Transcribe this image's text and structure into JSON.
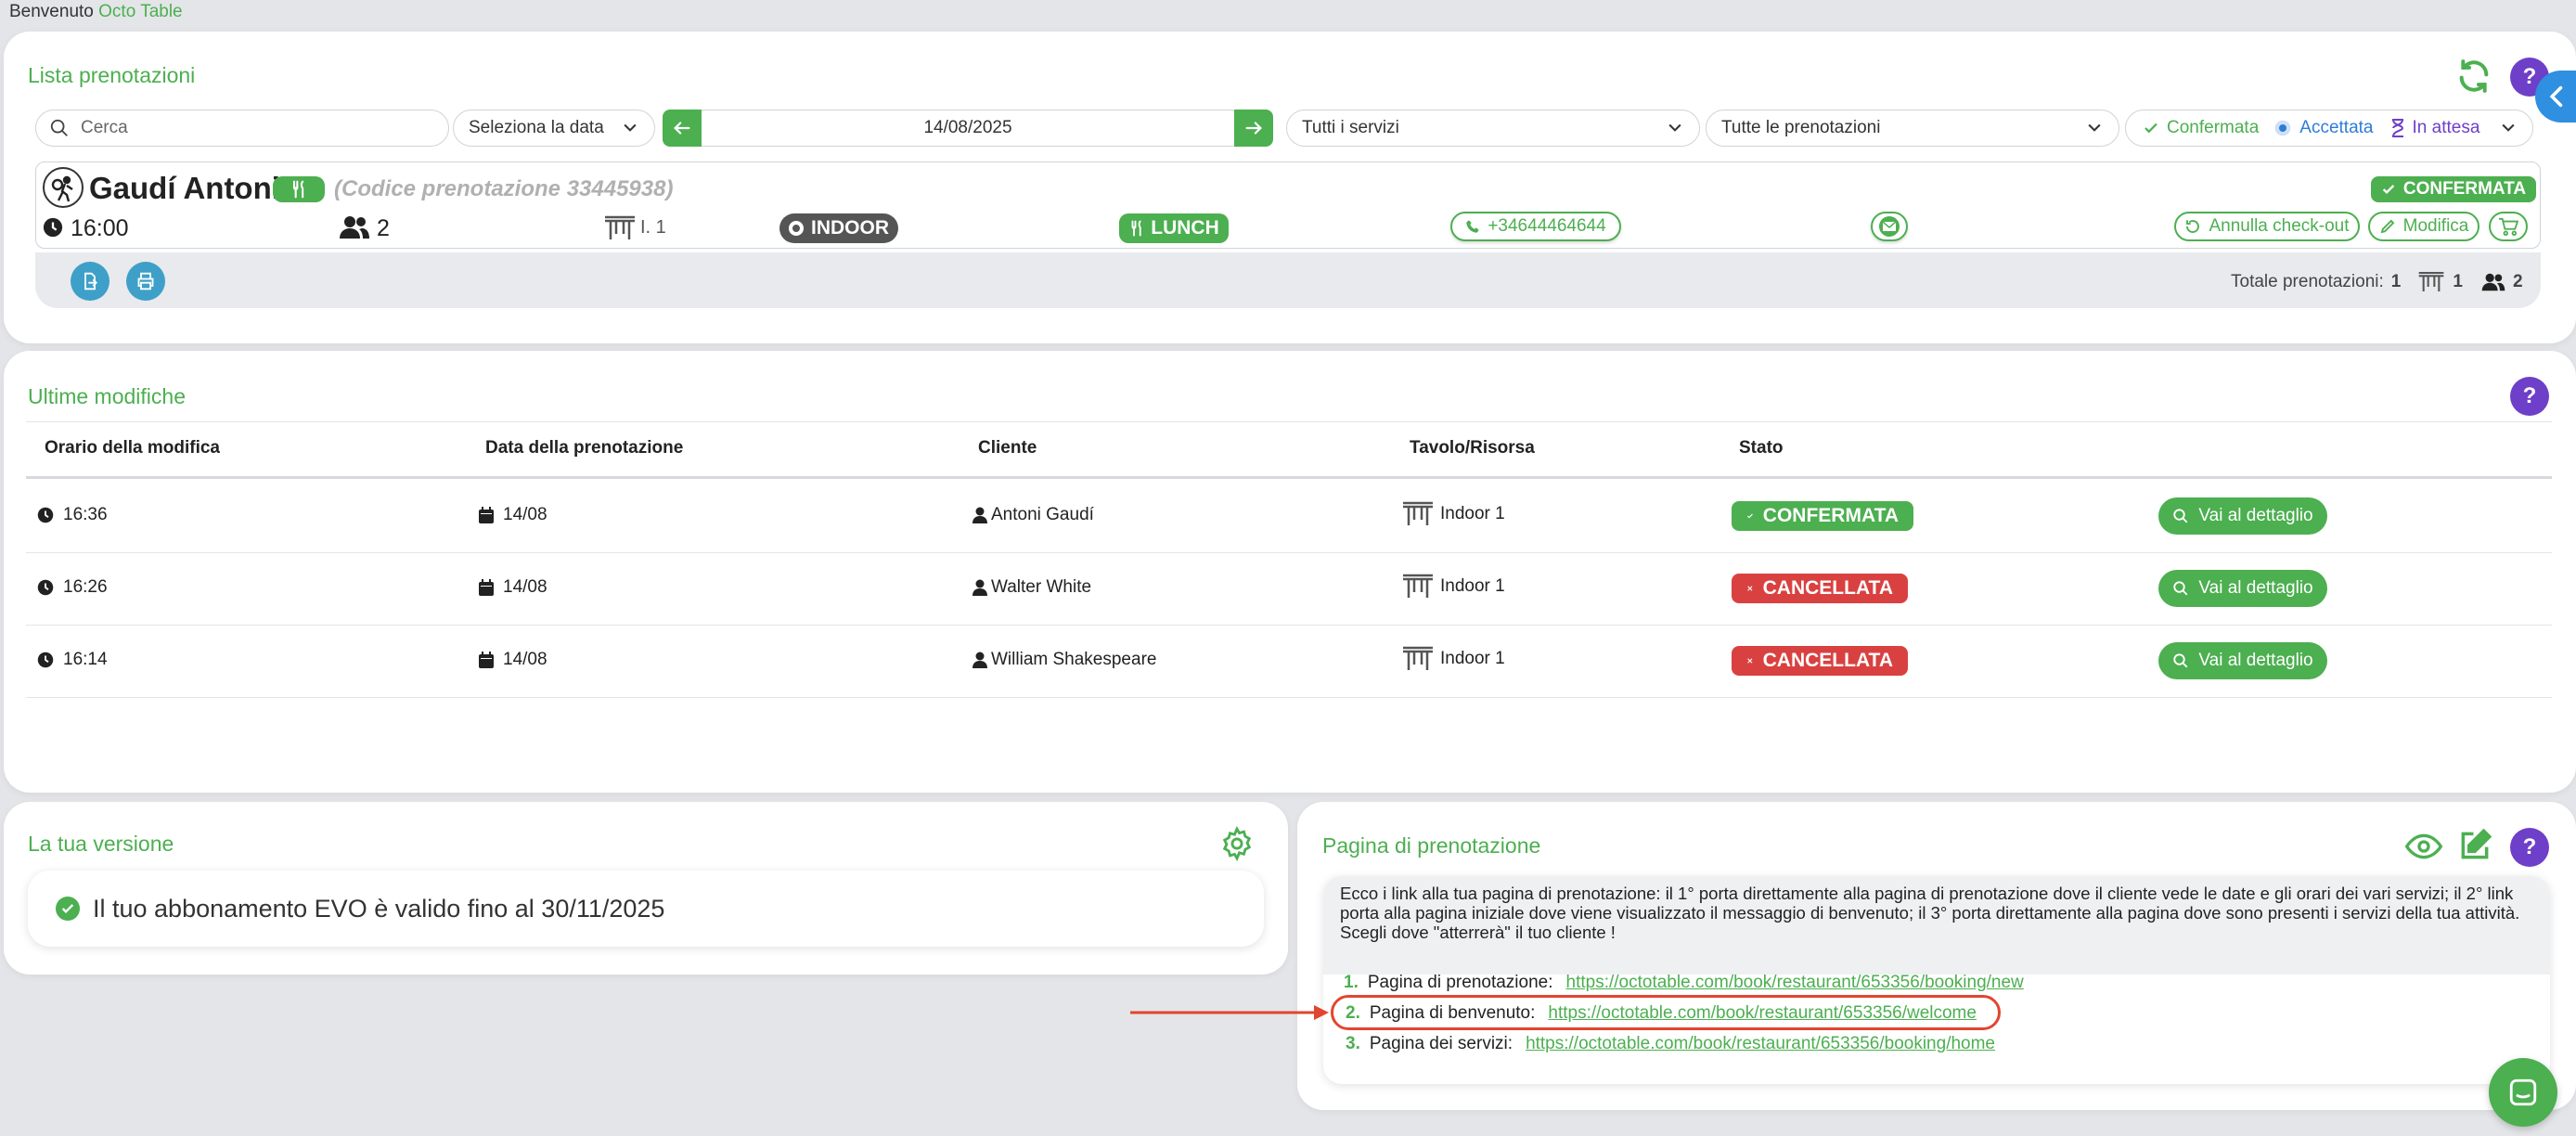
{
  "topbar": {
    "welcome": "Benvenuto",
    "brand": "Octo Table"
  },
  "bookings_list": {
    "title": "Lista prenotazioni",
    "search_placeholder": "Cerca",
    "date_select": "Seleziona la data",
    "date_value": "14/08/2025",
    "services_select": "Tutti i servizi",
    "bookings_select": "Tutte le prenotazioni",
    "legend": {
      "confirmed": "Confermata",
      "accepted": "Accettata",
      "waiting": "In attesa"
    },
    "booking": {
      "name": "Gaudí Antoni",
      "code": "(Codice prenotazione 33445938)",
      "status": "CONFERMATA",
      "time": "16:00",
      "guests": "2",
      "table": "I. 1",
      "area": "INDOOR",
      "service": "LUNCH",
      "phone": "+34644464644",
      "undo_checkout": "Annulla check-out",
      "edit": "Modifica"
    },
    "totals": {
      "label": "Totale prenotazioni:",
      "bookings": "1",
      "tables": "1",
      "guests": "2"
    }
  },
  "recent_changes": {
    "title": "Ultime modifiche",
    "headers": [
      "Orario della modifica",
      "Data della prenotazione",
      "Cliente",
      "Tavolo/Risorsa",
      "Stato"
    ],
    "detail_label": "Vai al dettaglio",
    "rows": [
      {
        "time": "16:36",
        "date": "14/08",
        "client": "Antoni Gaudí",
        "table": "Indoor 1",
        "status": "CONFERMATA",
        "status_color": "#4caf50"
      },
      {
        "time": "16:26",
        "date": "14/08",
        "client": "Walter White",
        "table": "Indoor 1",
        "status": "CANCELLATA",
        "status_color": "#d94141"
      },
      {
        "time": "16:14",
        "date": "14/08",
        "client": "William Shakespeare",
        "table": "Indoor 1",
        "status": "CANCELLATA",
        "status_color": "#d94141"
      }
    ]
  },
  "version": {
    "title": "La tua versione",
    "message": "Il tuo abbonamento EVO è valido fino al 30/11/2025"
  },
  "booking_page": {
    "title": "Pagina di prenotazione",
    "description": "Ecco i link alla tua pagina di prenotazione: il 1° porta direttamente alla pagina di prenotazione dove il cliente vede le date e gli orari dei vari servizi; il 2° link porta alla pagina iniziale dove viene visualizzato il messaggio di benvenuto; il 3° porta direttamente alla pagina dove sono presenti i servizi della tua attività. Scegli dove \"atterrerà\" il tuo cliente !",
    "links": [
      {
        "num": "1.",
        "label": "Pagina di prenotazione:",
        "url": "https://octotable.com/book/restaurant/653356/booking/new"
      },
      {
        "num": "2.",
        "label": "Pagina di benvenuto:",
        "url": "https://octotable.com/book/restaurant/653356/welcome"
      },
      {
        "num": "3.",
        "label": "Pagina dei servizi:",
        "url": "https://octotable.com/book/restaurant/653356/booking/home"
      }
    ]
  },
  "colors": {
    "brand": "#4caf50",
    "help": "#6e3fc8",
    "accepted": "#2f7bd8",
    "cancelled": "#d94141",
    "annotation": "#e2452f"
  }
}
